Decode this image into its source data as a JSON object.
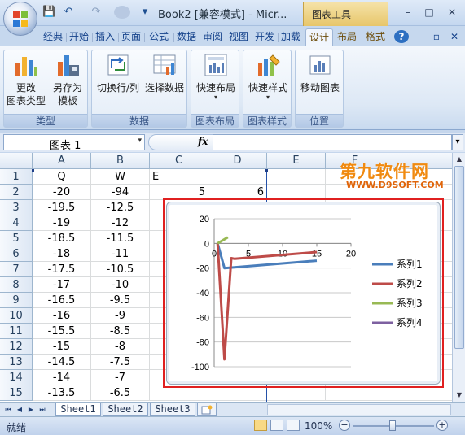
{
  "window": {
    "title": "Book2  [兼容模式] - Micr...",
    "context_tab_header": "图表工具",
    "controls": {
      "minimize": "–",
      "maximize": "□",
      "close": "✕"
    }
  },
  "quick_access": {
    "save": "💾",
    "undo": "↶",
    "redo": "↷",
    "customize": "▾"
  },
  "tabs": [
    "经典",
    "开始",
    "插入",
    "页面",
    "公式",
    "数据",
    "审阅",
    "视图",
    "开发",
    "加载",
    "设计",
    "布局",
    "格式"
  ],
  "active_tab": "设计",
  "tab_icons": {
    "help": "?",
    "mini_min": "–",
    "mini_restore": "▫",
    "mini_close": "✕"
  },
  "ribbon": {
    "groups": [
      {
        "label": "类型",
        "buttons": [
          {
            "label_1": "更改",
            "label_2": "图表类型"
          },
          {
            "label_1": "另存为",
            "label_2": "模板"
          }
        ]
      },
      {
        "label": "数据",
        "buttons": [
          {
            "label_1": "切换行/列"
          },
          {
            "label_1": "选择数据"
          }
        ]
      },
      {
        "label": "图表布局",
        "buttons": [
          {
            "label_1": "快速布局",
            "dropdown": "▾"
          }
        ]
      },
      {
        "label": "图表样式",
        "buttons": [
          {
            "label_1": "快速样式",
            "dropdown": "▾"
          }
        ]
      },
      {
        "label": "位置",
        "buttons": [
          {
            "label_1": "移动图表"
          }
        ]
      }
    ]
  },
  "formula_bar": {
    "name_box": "图表 1",
    "dropdown": "▾",
    "fx": "fx",
    "expand": "▾",
    "formula": ""
  },
  "columns": [
    "A",
    "B",
    "C",
    "D",
    "E",
    "F"
  ],
  "rows": [
    {
      "n": "1",
      "A": "Q",
      "B": "W",
      "C": "E",
      "D": "",
      "E": ""
    },
    {
      "n": "2",
      "A": "-20",
      "B": "-94",
      "C": "5",
      "D": "6",
      "E": ""
    },
    {
      "n": "3",
      "A": "-19.5",
      "B": "-12.5"
    },
    {
      "n": "4",
      "A": "-19",
      "B": "-12"
    },
    {
      "n": "5",
      "A": "-18.5",
      "B": "-11.5"
    },
    {
      "n": "6",
      "A": "-18",
      "B": "-11"
    },
    {
      "n": "7",
      "A": "-17.5",
      "B": "-10.5"
    },
    {
      "n": "8",
      "A": "-17",
      "B": "-10"
    },
    {
      "n": "9",
      "A": "-16.5",
      "B": "-9.5"
    },
    {
      "n": "10",
      "A": "-16",
      "B": "-9"
    },
    {
      "n": "11",
      "A": "-15.5",
      "B": "-8.5"
    },
    {
      "n": "12",
      "A": "-15",
      "B": "-8"
    },
    {
      "n": "13",
      "A": "-14.5",
      "B": "-7.5"
    },
    {
      "n": "14",
      "A": "-14",
      "B": "-7"
    },
    {
      "n": "15",
      "A": "-13.5",
      "B": "-6.5"
    }
  ],
  "watermark": {
    "big": "第九软件网",
    "small": "WWW.D9SOFT.COM"
  },
  "chart_data": {
    "type": "line",
    "title": "",
    "xlabel": "",
    "ylabel": "",
    "xlim": [
      0,
      20
    ],
    "ylim": [
      -100,
      20
    ],
    "x_ticks": [
      "0",
      "5",
      "10",
      "15",
      "20"
    ],
    "y_ticks": [
      "20",
      "0",
      "-20",
      "-40",
      "-60",
      "-80",
      "-100"
    ],
    "grid": true,
    "legend": "right",
    "series": [
      {
        "name": "系列1",
        "color": "#4a7ebb",
        "points": [
          [
            0.5,
            0
          ],
          [
            1.5,
            -20
          ],
          [
            15,
            -14
          ]
        ]
      },
      {
        "name": "系列2",
        "color": "#be4b48",
        "points": [
          [
            0.5,
            0
          ],
          [
            1.5,
            -94
          ],
          [
            2.5,
            -12
          ],
          [
            3,
            -12.5
          ],
          [
            15,
            -7
          ]
        ]
      },
      {
        "name": "系列3",
        "color": "#98b954",
        "points": [
          [
            0.5,
            0
          ],
          [
            2,
            5
          ]
        ]
      },
      {
        "name": "系列4",
        "color": "#7d60a0",
        "points": []
      }
    ]
  },
  "sheet_tabs": [
    "Sheet1",
    "Sheet2",
    "Sheet3"
  ],
  "sheet_nav": [
    "⏮",
    "◀",
    "▶",
    "⏭"
  ],
  "status": {
    "ready": "就绪",
    "zoom": "100%",
    "zoom_minus": "−",
    "zoom_plus": "+"
  }
}
